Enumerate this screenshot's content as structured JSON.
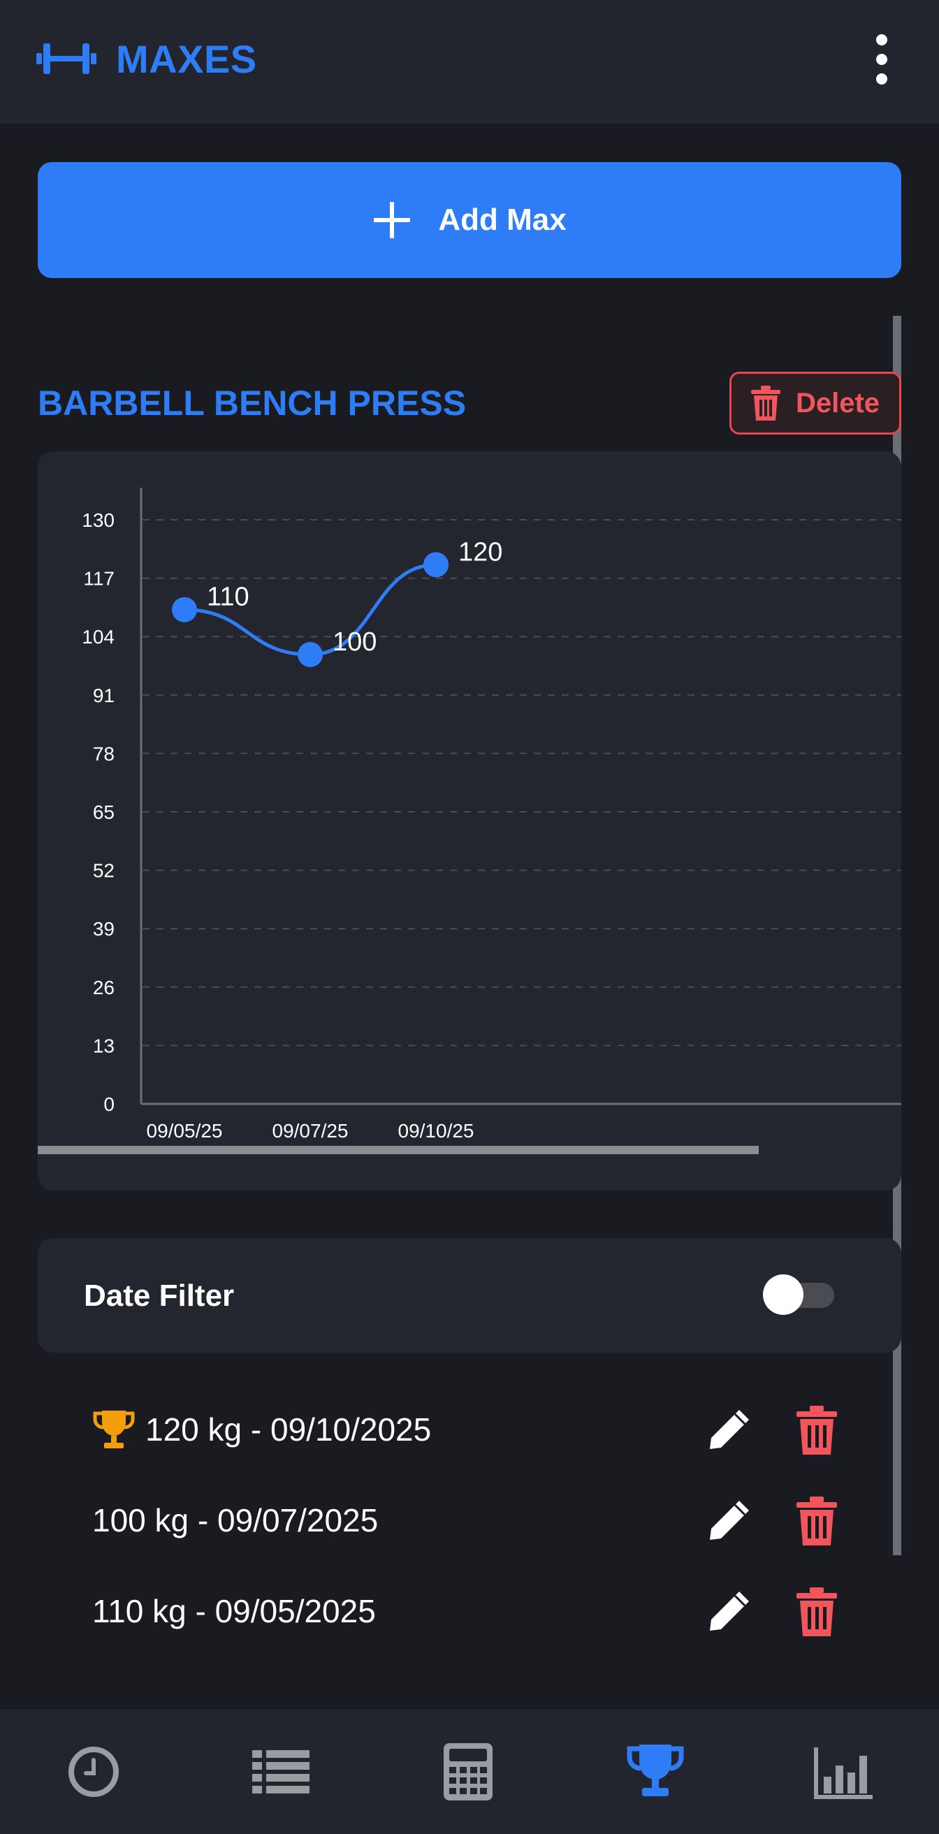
{
  "app_bar": {
    "title": "MAXES",
    "brand_icon": "dumbbell-icon",
    "overflow_icon": "more-vert-icon"
  },
  "add_button": {
    "label": "Add Max",
    "icon": "plus-icon"
  },
  "exercise": {
    "title": "BARBELL BENCH PRESS",
    "delete_label": "Delete",
    "delete_icon": "trash-icon"
  },
  "chart_data": {
    "type": "line",
    "title": "",
    "xlabel": "",
    "ylabel": "",
    "x": [
      "09/05/25",
      "09/07/25",
      "09/10/25"
    ],
    "series": [
      {
        "values": [
          110,
          100,
          120
        ]
      }
    ],
    "y_ticks": [
      "0",
      "13",
      "26",
      "39",
      "52",
      "65",
      "78",
      "91",
      "104",
      "117",
      "130"
    ],
    "ylim": [
      0,
      130
    ],
    "grid": true,
    "data_labels": [
      "110",
      "100",
      "120"
    ],
    "line_color": "#2f7df6"
  },
  "date_filter": {
    "label": "Date Filter",
    "enabled": false
  },
  "entries": [
    {
      "text": "120 kg - 09/10/2025",
      "is_best": true
    },
    {
      "text": "100 kg - 09/07/2025",
      "is_best": false
    },
    {
      "text": "110 kg - 09/05/2025",
      "is_best": false
    }
  ],
  "bottom_nav": {
    "items": [
      {
        "icon": "clock-icon",
        "active": false
      },
      {
        "icon": "list-icon",
        "active": false
      },
      {
        "icon": "calculator-icon",
        "active": false
      },
      {
        "icon": "trophy-icon",
        "active": true
      },
      {
        "icon": "bar-chart-icon",
        "active": false
      }
    ]
  },
  "colors": {
    "accent": "#2f7df6",
    "danger": "#f0565b",
    "trophy": "#f59e0b",
    "background": "#1a1b20",
    "card": "#23262e",
    "inactive_icon": "#9a9ca1"
  }
}
